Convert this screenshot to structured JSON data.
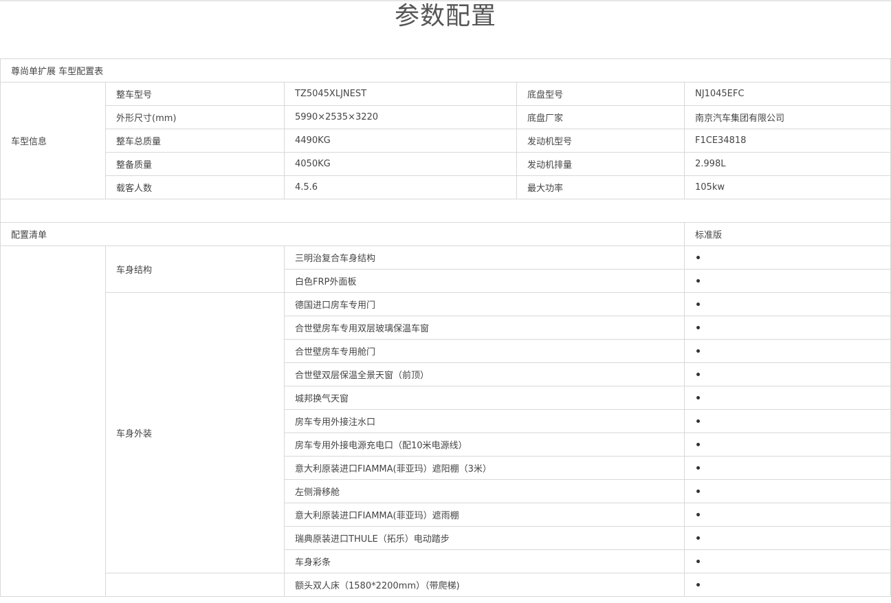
{
  "page_title": "参数配置",
  "table_title": "尊尚单扩展  车型配置表",
  "vehicle_info": {
    "label": "车型信息",
    "rows": [
      {
        "k1": "整车型号",
        "v1": "TZ5045XLJNEST",
        "k2": "底盘型号",
        "v2": "NJ1045EFC"
      },
      {
        "k1": "外形尺寸(mm)",
        "v1": "5990×2535×3220",
        "k2": "底盘厂家",
        "v2": "南京汽车集团有限公司"
      },
      {
        "k1": "整车总质量",
        "v1": "4490KG",
        "k2": "发动机型号",
        "v2": "F1CE34818"
      },
      {
        "k1": "整备质量",
        "v1": "4050KG",
        "k2": "发动机排量",
        "v2": "2.998L"
      },
      {
        "k1": "载客人数",
        "v1": "4.5.6",
        "k2": "最大功率",
        "v2": "105kw"
      }
    ]
  },
  "config": {
    "label": "配置清单",
    "version_label": "标准版",
    "groups": [
      {
        "name": "车身结构",
        "items": [
          "三明治复合车身结构",
          "白色FRP外面板"
        ]
      },
      {
        "name": "车身外装",
        "items": [
          "德国进口房车专用门",
          "合世壁房车专用双层玻璃保温车窗",
          "合世壁房车专用舱门",
          "合世壁双层保温全景天窗（前顶）",
          "城邦换气天窗",
          "房车专用外接注水口",
          "房车专用外接电源充电口（配10米电源线）",
          "意大利原装进口FIAMMA(菲亚玛）遮阳棚（3米）",
          "左侧滑移舱",
          "意大利原装进口FIAMMA(菲亚玛）遮雨棚",
          "瑞典原装进口THULE（拓乐）电动踏步",
          "车身彩条"
        ]
      },
      {
        "name": "",
        "items": [
          "额头双人床（1580*2200mm）（带爬梯)"
        ]
      }
    ]
  }
}
